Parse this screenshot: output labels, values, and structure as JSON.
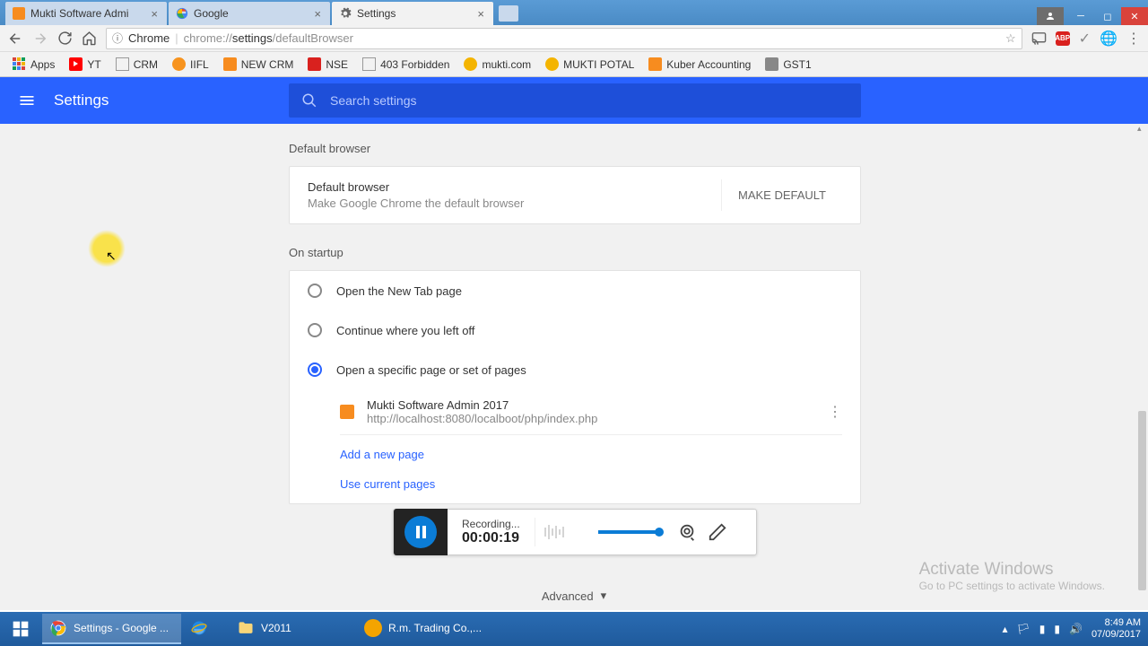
{
  "window": {
    "tabs": [
      {
        "title": "Mukti Software Admi",
        "active": false
      },
      {
        "title": "Google",
        "active": false
      },
      {
        "title": "Settings",
        "active": true
      }
    ]
  },
  "address": {
    "secure_label": "Chrome",
    "host": "chrome://",
    "bold": "settings",
    "rest": "/defaultBrowser"
  },
  "bookmarks": [
    {
      "label": "Apps"
    },
    {
      "label": "YT"
    },
    {
      "label": "CRM"
    },
    {
      "label": "IIFL"
    },
    {
      "label": "NEW CRM"
    },
    {
      "label": "NSE"
    },
    {
      "label": "403 Forbidden"
    },
    {
      "label": "mukti.com"
    },
    {
      "label": "MUKTI POTAL"
    },
    {
      "label": "Kuber Accounting"
    },
    {
      "label": "GST1"
    }
  ],
  "settings": {
    "title": "Settings",
    "search_placeholder": "Search settings",
    "sections": {
      "default_browser": {
        "heading": "Default browser",
        "title": "Default browser",
        "subtitle": "Make Google Chrome the default browser",
        "button": "MAKE DEFAULT"
      },
      "startup": {
        "heading": "On startup",
        "options": [
          {
            "label": "Open the New Tab page",
            "selected": false
          },
          {
            "label": "Continue where you left off",
            "selected": false
          },
          {
            "label": "Open a specific page or set of pages",
            "selected": true
          }
        ],
        "pages": [
          {
            "title": "Mukti Software Admin 2017",
            "url": "http://localhost:8080/localboot/php/index.php"
          }
        ],
        "add_page": "Add a new page",
        "use_current": "Use current pages"
      }
    },
    "advanced": "Advanced"
  },
  "recorder": {
    "status": "Recording...",
    "time": "00:00:19"
  },
  "watermark": {
    "title": "Activate Windows",
    "sub": "Go to PC settings to activate Windows."
  },
  "taskbar": {
    "items": [
      {
        "label": "Settings - Google ..."
      },
      {
        "label": ""
      },
      {
        "label": "V2011"
      },
      {
        "label": "R.m. Trading Co.,..."
      }
    ],
    "time": "8:49 AM",
    "date": "07/09/2017"
  }
}
